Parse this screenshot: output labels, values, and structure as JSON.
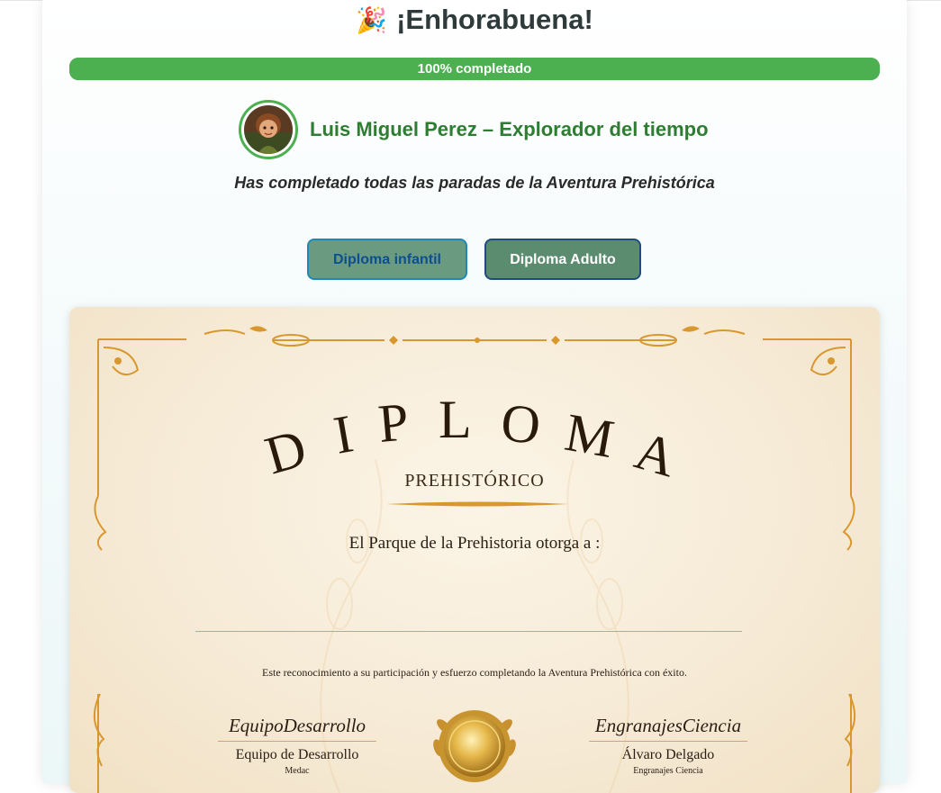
{
  "header": {
    "emoji": "🎉",
    "title": "¡Enhorabuena!"
  },
  "progress": {
    "value": 100,
    "label": "100% completado",
    "color": "#4caf50"
  },
  "profile": {
    "name": "Luis Miguel Perez – Explorador del tiempo",
    "avatar_icon": "child-explorer-avatar"
  },
  "subtitle": "Has completado todas las paradas de la Aventura Prehistórica",
  "buttons": {
    "child_label": "Diploma infantil",
    "adult_label": "Diploma Adulto"
  },
  "diploma": {
    "title_letters": [
      "D",
      "I",
      "P",
      "L",
      "O",
      "M",
      "A"
    ],
    "subtitle": "PREHISTÓRICO",
    "grant_text": "El Parque de la Prehistoria otorga a :",
    "recipient": "",
    "body": "Este reconocimiento a su participación y esfuerzo completando la Aventura Prehistórica con éxito.",
    "signatures": [
      {
        "script": "EquipoDesarrollo",
        "name": "Equipo de Desarrollo",
        "org": "Medac"
      },
      {
        "script": "EngranajesCiencia",
        "name": "Álvaro Delgado",
        "org": "Engranajes Ciencia"
      }
    ],
    "accent_color": "#d9a457",
    "seal_icon": "gold-seal-icon"
  }
}
